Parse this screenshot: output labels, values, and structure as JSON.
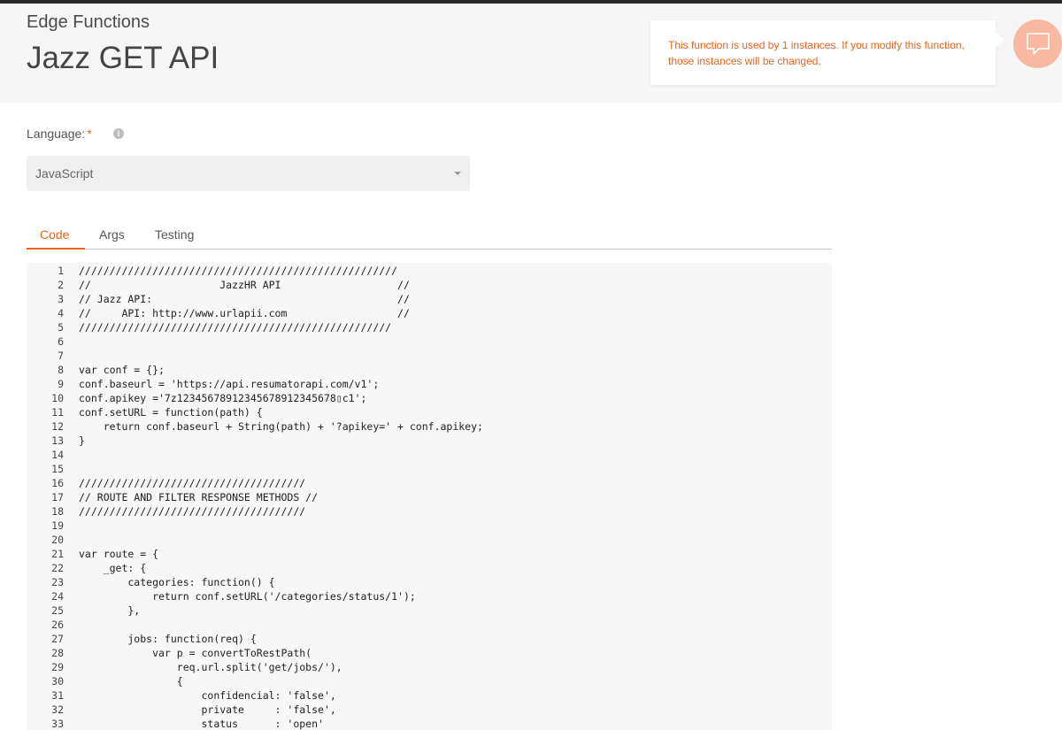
{
  "header": {
    "breadcrumb": "Edge Functions",
    "title": "Jazz GET API"
  },
  "notice": {
    "text": "This function is used by 1 instances. If you modify this function, those instances will be changed.",
    "icon": "chat-bubble-icon",
    "accent": "#e8641b"
  },
  "language": {
    "label": "Language:",
    "required_mark": "*",
    "info_icon": "info-icon",
    "selected": "JavaScript"
  },
  "tabs": [
    {
      "label": "Code",
      "active": true
    },
    {
      "label": "Args",
      "active": false
    },
    {
      "label": "Testing",
      "active": false
    }
  ],
  "code": {
    "lines": [
      "////////////////////////////////////////////////////",
      "//                     JazzHR API                   //",
      "// Jazz API:                                        //",
      "//     API: http://www.urlapii.com                  //",
      "///////////////////////////////////////////////////",
      "",
      "",
      "var conf = {};",
      "conf.baseurl = 'https://api.resumatorapi.com/v1';",
      "conf.apikey ='7z12345678912345678912345678▯c1';",
      "conf.setURL = function(path) {",
      "    return conf.baseurl + String(path) + '?apikey=' + conf.apikey;",
      "}",
      "",
      "",
      "/////////////////////////////////////",
      "// ROUTE AND FILTER RESPONSE METHODS //",
      "/////////////////////////////////////",
      "",
      "",
      "var route = {",
      "    _get: {",
      "        categories: function() {",
      "            return conf.setURL('/categories/status/1');",
      "        },",
      "",
      "        jobs: function(req) {",
      "            var p = convertToRestPath(",
      "                req.url.split('get/jobs/'),",
      "                {",
      "                    confidencial: 'false',",
      "                    private     : 'false',",
      "                    status      : 'open'"
    ]
  }
}
